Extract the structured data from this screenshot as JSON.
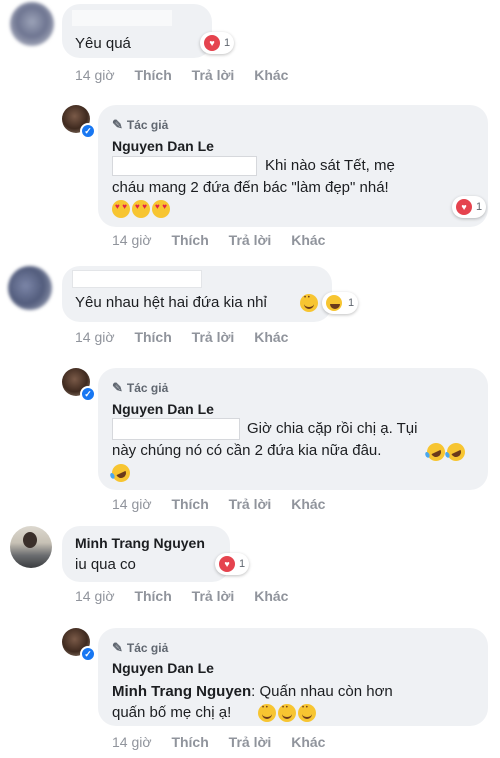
{
  "actions": {
    "time": "14 giờ",
    "like": "Thích",
    "reply": "Trả lời",
    "more": "Khác"
  },
  "author_tag": "Tác giả",
  "comments": [
    {
      "text": "Yêu quá",
      "reaction_count": "1"
    },
    {
      "author": "Nguyen Dan Le",
      "line1": "Khi nào sát Tết, mẹ",
      "line2": "cháu mang 2 đứa đến bác \"làm đẹp\" nhá!",
      "reaction_count": "1"
    },
    {
      "text": "Yêu nhau hệt hai đứa kia nhỉ",
      "reaction_count": "1"
    },
    {
      "author": "Nguyen Dan Le",
      "line1": "Giờ chia cặp rồi chị ạ. Tụi",
      "line2": "này chúng nó có cần 2 đứa kia nữa đâu."
    },
    {
      "author": "Minh Trang Nguyen",
      "text": "iu qua co",
      "reaction_count": "1"
    },
    {
      "author": "Nguyen Dan Le",
      "mention": "Minh Trang Nguyen",
      "text": ": Quấn nhau còn hơn",
      "line2": "quấn bố mẹ chị ạ!"
    }
  ]
}
